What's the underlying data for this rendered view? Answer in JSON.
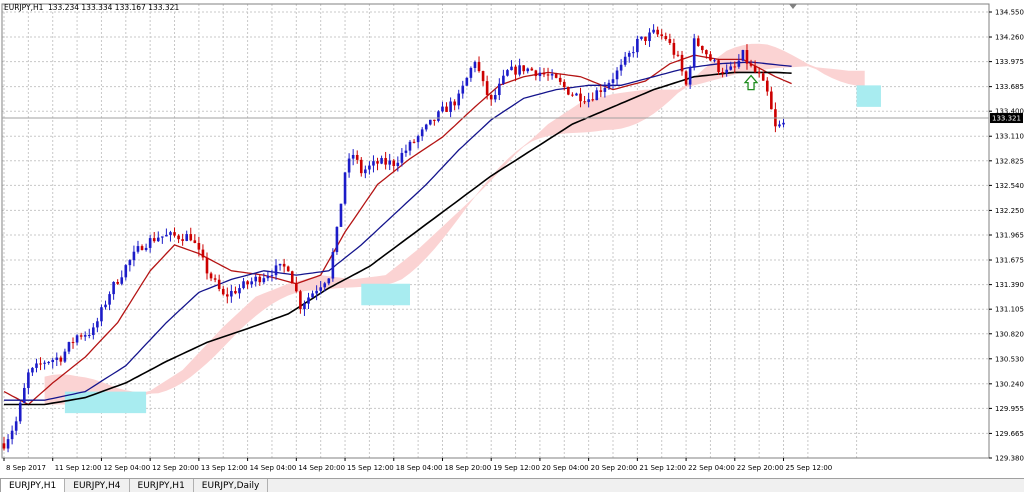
{
  "header": {
    "symbol": "EURJPY,H1",
    "ohlc": "133.234 133.334 133.167 133.321"
  },
  "tabs": [
    {
      "label": "EURJPY,H1",
      "active": true
    },
    {
      "label": "EURJPY,H4",
      "active": false
    },
    {
      "label": "EURJPY,H1",
      "active": false
    },
    {
      "label": "EURJPY,Daily",
      "active": false
    }
  ],
  "colors": {
    "bull": "#1c1cc8",
    "bear": "#cc0000",
    "ma_fast": "#b41414",
    "ma_mid": "#14148c",
    "ma_slow": "#000000",
    "cloud_bear": "#fbd3d3",
    "cloud_bull": "#a8ecf0",
    "grid": "#c8c8c8",
    "arrow": "#1e8c1e"
  },
  "chart_data": {
    "type": "candlestick",
    "title": "EURJPY,H1",
    "current_price": "133.321",
    "ylim": [
      129.38,
      134.55
    ],
    "y_ticks": [
      "134.550",
      "134.260",
      "133.975",
      "133.685",
      "133.400",
      "133.110",
      "132.825",
      "132.540",
      "132.250",
      "131.965",
      "131.675",
      "131.390",
      "131.105",
      "130.820",
      "130.530",
      "130.240",
      "129.955",
      "129.665",
      "129.380"
    ],
    "x_ticks": [
      {
        "label": "8 Sep 2017",
        "bar": 0
      },
      {
        "label": "11 Sep 12:00",
        "bar": 12
      },
      {
        "label": "12 Sep 04:00",
        "bar": 24
      },
      {
        "label": "12 Sep 20:00",
        "bar": 36
      },
      {
        "label": "13 Sep 12:00",
        "bar": 48
      },
      {
        "label": "14 Sep 04:00",
        "bar": 60
      },
      {
        "label": "14 Sep 20:00",
        "bar": 72
      },
      {
        "label": "15 Sep 12:00",
        "bar": 84
      },
      {
        "label": "18 Sep 04:00",
        "bar": 96
      },
      {
        "label": "18 Sep 20:00",
        "bar": 108
      },
      {
        "label": "19 Sep 12:00",
        "bar": 120
      },
      {
        "label": "20 Sep 04:00",
        "bar": 132
      },
      {
        "label": "20 Sep 20:00",
        "bar": 144
      },
      {
        "label": "21 Sep 12:00",
        "bar": 156
      },
      {
        "label": "22 Sep 04:00",
        "bar": 168
      },
      {
        "label": "22 Sep 20:00",
        "bar": 180
      },
      {
        "label": "25 Sep 12:00",
        "bar": 192
      }
    ],
    "price_path": [
      [
        0,
        129.55
      ],
      [
        3,
        129.8
      ],
      [
        6,
        130.35
      ],
      [
        10,
        130.5
      ],
      [
        14,
        130.55
      ],
      [
        18,
        130.8
      ],
      [
        22,
        130.85
      ],
      [
        26,
        131.3
      ],
      [
        30,
        131.6
      ],
      [
        34,
        131.85
      ],
      [
        38,
        131.95
      ],
      [
        42,
        131.95
      ],
      [
        46,
        131.95
      ],
      [
        50,
        131.55
      ],
      [
        54,
        131.25
      ],
      [
        58,
        131.35
      ],
      [
        62,
        131.45
      ],
      [
        66,
        131.55
      ],
      [
        70,
        131.6
      ],
      [
        73,
        131.15
      ],
      [
        76,
        131.3
      ],
      [
        80,
        131.5
      ],
      [
        82,
        132.0
      ],
      [
        84,
        132.7
      ],
      [
        86,
        132.9
      ],
      [
        88,
        132.7
      ],
      [
        92,
        132.8
      ],
      [
        96,
        132.8
      ],
      [
        100,
        133.0
      ],
      [
        104,
        133.2
      ],
      [
        108,
        133.4
      ],
      [
        112,
        133.55
      ],
      [
        116,
        134.0
      ],
      [
        118,
        133.7
      ],
      [
        120,
        133.5
      ],
      [
        124,
        133.85
      ],
      [
        128,
        133.9
      ],
      [
        132,
        133.85
      ],
      [
        136,
        133.75
      ],
      [
        140,
        133.6
      ],
      [
        144,
        133.55
      ],
      [
        148,
        133.7
      ],
      [
        152,
        133.9
      ],
      [
        156,
        134.2
      ],
      [
        160,
        134.3
      ],
      [
        163,
        134.25
      ],
      [
        166,
        134.0
      ],
      [
        168,
        133.7
      ],
      [
        170,
        134.2
      ],
      [
        172,
        134.15
      ],
      [
        174,
        134.0
      ],
      [
        176,
        133.9
      ],
      [
        178,
        133.85
      ],
      [
        180,
        133.9
      ],
      [
        182,
        134.05
      ],
      [
        184,
        133.9
      ],
      [
        186,
        133.8
      ],
      [
        188,
        133.6
      ],
      [
        190,
        133.2
      ],
      [
        192,
        133.25
      ]
    ],
    "series": [
      {
        "values": [
          [
            0,
            130.15
          ],
          [
            6,
            130.0
          ],
          [
            12,
            130.25
          ],
          [
            20,
            130.55
          ],
          [
            28,
            130.95
          ],
          [
            36,
            131.55
          ],
          [
            42,
            131.85
          ],
          [
            48,
            131.75
          ],
          [
            56,
            131.55
          ],
          [
            64,
            131.5
          ],
          [
            72,
            131.4
          ],
          [
            78,
            131.5
          ],
          [
            84,
            132.0
          ],
          [
            92,
            132.55
          ],
          [
            100,
            132.85
          ],
          [
            108,
            133.1
          ],
          [
            116,
            133.45
          ],
          [
            122,
            133.7
          ],
          [
            128,
            133.8
          ],
          [
            134,
            133.85
          ],
          [
            142,
            133.8
          ],
          [
            150,
            133.65
          ],
          [
            158,
            133.75
          ],
          [
            164,
            133.95
          ],
          [
            170,
            134.05
          ],
          [
            176,
            134.0
          ],
          [
            182,
            134.0
          ],
          [
            186,
            133.9
          ],
          [
            190,
            133.8
          ],
          [
            194,
            133.72
          ]
        ]
      },
      {
        "values": [
          [
            0,
            130.05
          ],
          [
            10,
            130.05
          ],
          [
            20,
            130.15
          ],
          [
            30,
            130.45
          ],
          [
            40,
            130.95
          ],
          [
            48,
            131.3
          ],
          [
            56,
            131.45
          ],
          [
            64,
            131.55
          ],
          [
            72,
            131.5
          ],
          [
            80,
            131.55
          ],
          [
            88,
            131.85
          ],
          [
            96,
            132.2
          ],
          [
            104,
            132.55
          ],
          [
            112,
            132.95
          ],
          [
            120,
            133.3
          ],
          [
            128,
            133.55
          ],
          [
            136,
            133.65
          ],
          [
            144,
            133.7
          ],
          [
            152,
            133.7
          ],
          [
            160,
            133.8
          ],
          [
            168,
            133.9
          ],
          [
            176,
            133.95
          ],
          [
            184,
            133.97
          ],
          [
            188,
            133.95
          ],
          [
            194,
            133.92
          ]
        ]
      },
      {
        "values": [
          [
            0,
            130.0
          ],
          [
            10,
            130.0
          ],
          [
            20,
            130.08
          ],
          [
            30,
            130.25
          ],
          [
            40,
            130.5
          ],
          [
            50,
            130.72
          ],
          [
            60,
            130.88
          ],
          [
            70,
            131.05
          ],
          [
            80,
            131.35
          ],
          [
            90,
            131.6
          ],
          [
            100,
            131.95
          ],
          [
            110,
            132.3
          ],
          [
            120,
            132.65
          ],
          [
            130,
            132.95
          ],
          [
            140,
            133.25
          ],
          [
            150,
            133.45
          ],
          [
            160,
            133.65
          ],
          [
            170,
            133.8
          ],
          [
            180,
            133.85
          ],
          [
            190,
            133.85
          ],
          [
            194,
            133.84
          ]
        ]
      }
    ]
  }
}
